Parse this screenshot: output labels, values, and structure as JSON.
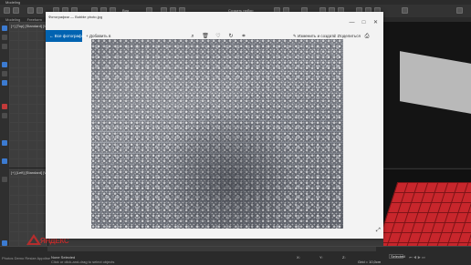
{
  "app_3d": {
    "menu": [
      "Modeling",
      "",
      "",
      "",
      "",
      "",
      "",
      ""
    ],
    "toolbar_view": "Вид",
    "toolbar_set_label": "Создать набор",
    "ribbon": [
      "Modeling",
      "Freeform",
      "Selection",
      "Object Paint",
      "Populate"
    ],
    "viewport_left_top_label": "[+] [Top] [Standard] [Wire]",
    "viewport_left_bottom_label": "[+] [Left] [Standard] [Wire]",
    "status_selected": "None Selected",
    "status_hint": "Click or click-and-drag to select objects",
    "status_x": "X:",
    "status_y": "Y:",
    "status_z": "Z:",
    "status_grid": "Grid = 10,0cm",
    "selection_mode": "Selected",
    "logo_text": "ЯНДЕКС",
    "bottom_left_label": "Photos Demo Resize Appdise"
  },
  "photos_window": {
    "title": "Фотографии — Bubble photo.jpg",
    "nav_all_photos": "Все фотографии",
    "nav_add": "Добавить в",
    "cmd_edit_create": "Изменить и создать",
    "cmd_share": "Поделиться",
    "window_controls": [
      "—",
      "□",
      "✕"
    ]
  },
  "colors": {
    "accent_blue": "#0063b1",
    "floor_red": "#c8262c"
  }
}
